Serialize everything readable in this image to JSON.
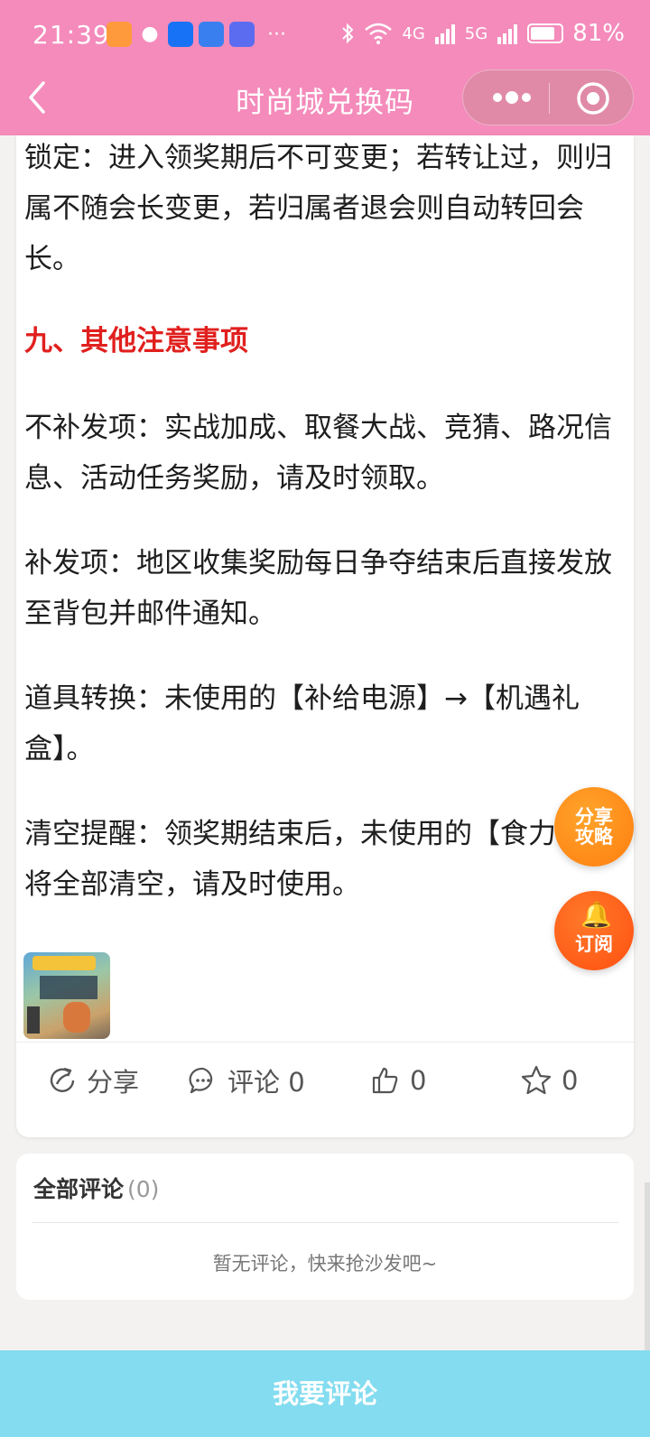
{
  "status_bar": {
    "time": "21:39",
    "more": "···",
    "net_4g": "4G",
    "net_5g": "5G",
    "battery_percent": "81%",
    "battery_level": 0.81,
    "app_icons": [
      "taobao-icon",
      "wechat-icon",
      "zhihu-icon",
      "contacts-icon",
      "music-icon"
    ]
  },
  "nav": {
    "title": "时尚城兑换码"
  },
  "article": {
    "paragraphs": [
      "锁定：进入领奖期后不可变更；若转让过，则归属不随会长变更，若归属者退会则自动转回会长。",
      "不补发项：实战加成、取餐大战、竞猜、路况信息、活动任务奖励，请及时领取。",
      "补发项：地区收集奖励每日争夺结束后直接发放至背包并邮件通知。",
      "道具转换：未使用的【补给电源】→【机遇礼盒】。",
      "清空提醒：领奖期结束后，未使用的【食力币】将全部清空，请及时使用。"
    ],
    "section_heading": "九、其他注意事项"
  },
  "actions": {
    "share_label": "分享",
    "comment_label": "评论 0",
    "like_count": "0",
    "favorite_count": "0"
  },
  "fab": {
    "share_line1": "分享",
    "share_line2": "攻略",
    "subscribe_label": "订阅"
  },
  "comments": {
    "title": "全部评论",
    "count": "(0)",
    "empty_text": "暂无评论，快来抢沙发吧~"
  },
  "bottom": {
    "comment_button": "我要评论"
  },
  "colors": {
    "header": "#f48bbb",
    "heading_red": "#e0201e",
    "bottom_bar": "#83dcef",
    "fab_orange": "#ff8a1c"
  }
}
